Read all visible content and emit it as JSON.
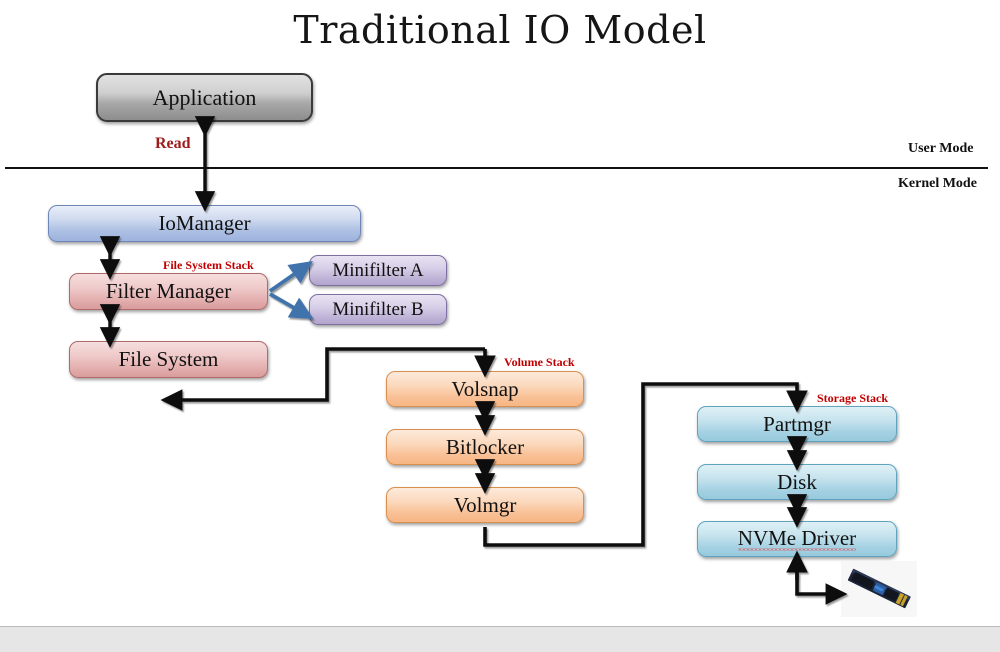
{
  "slide": {
    "title": "Traditional IO Model",
    "mode_labels": {
      "user": "User Mode",
      "kernel": "Kernel Mode"
    },
    "flow_label": "Read",
    "stack_labels": {
      "file_system": "File System Stack",
      "volume": "Volume Stack",
      "storage": "Storage Stack"
    },
    "nodes": {
      "application": "Application",
      "iomanager": "IoManager",
      "filter_manager": "Filter Manager",
      "file_system": "File System",
      "minifilter_a": "Minifilter A",
      "minifilter_b": "Minifilter B",
      "volsnap": "Volsnap",
      "bitlocker": "Bitlocker",
      "volmgr": "Volmgr",
      "partmgr": "Partmgr",
      "disk": "Disk",
      "nvme_driver": "NVMe Driver"
    },
    "device": "nvme-ssd-photo",
    "colors": {
      "application_fill": "#a9a9a9",
      "iomanager_fill": "#afc1e4",
      "file_system_stack_fill": "#e3aeae",
      "minifilter_fill": "#c0b4d8",
      "volume_stack_fill": "#f9c197",
      "storage_stack_fill": "#a6d2e3",
      "stack_label": "#c00000",
      "read_label": "#9e1b1b",
      "minifilter_arrow": "#3f72ab",
      "connector": "#111111",
      "bottom_bar": "#e6e6e6"
    }
  }
}
